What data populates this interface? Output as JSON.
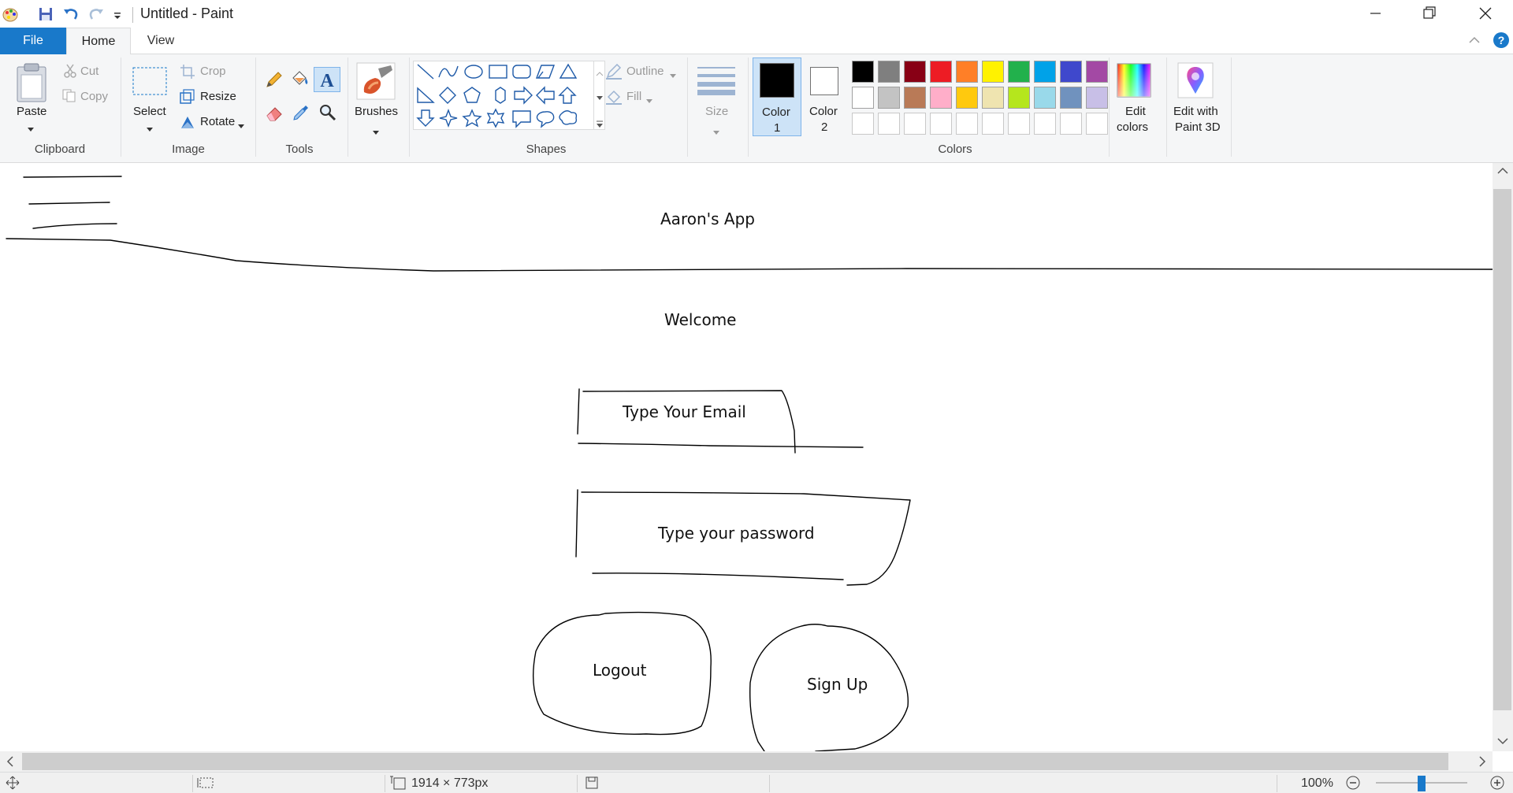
{
  "window": {
    "title": "Untitled - Paint"
  },
  "tabs": {
    "file": "File",
    "home": "Home",
    "view": "View"
  },
  "clipboard": {
    "paste": "Paste",
    "cut": "Cut",
    "copy": "Copy",
    "group": "Clipboard"
  },
  "image": {
    "select": "Select",
    "crop": "Crop",
    "resize": "Resize",
    "rotate": "Rotate",
    "group": "Image"
  },
  "tools": {
    "group": "Tools",
    "brushes": "Brushes"
  },
  "shapes": {
    "group": "Shapes",
    "outline": "Outline",
    "fill": "Fill"
  },
  "size": {
    "label": "Size"
  },
  "colors": {
    "color1_line1": "Color",
    "color1_line2": "1",
    "color2_line1": "Color",
    "color2_line2": "2",
    "group": "Colors",
    "edit_line1": "Edit",
    "edit_line2": "colors",
    "paint3d_line1": "Edit with",
    "paint3d_line2": "Paint 3D",
    "color1_value": "#000000",
    "color2_value": "#ffffff",
    "palette_row1": [
      "#000000",
      "#7f7f7f",
      "#880015",
      "#ed1c24",
      "#ff7f27",
      "#fff200",
      "#22b14c",
      "#00a2e8",
      "#3f48cc",
      "#a349a4"
    ],
    "palette_row2": [
      "#ffffff",
      "#c3c3c3",
      "#b97a57",
      "#ffaec9",
      "#ffc90e",
      "#efe4b0",
      "#b5e61d",
      "#99d9ea",
      "#7092be",
      "#c8bfe7"
    ]
  },
  "canvas": {
    "app_title": "Aaron's App",
    "welcome": "Welcome",
    "email": "Type Your Email",
    "password": "Type your password",
    "logout": "Logout",
    "signup": "Sign Up"
  },
  "status": {
    "dimensions": "1914 × 773px",
    "zoom": "100%"
  }
}
